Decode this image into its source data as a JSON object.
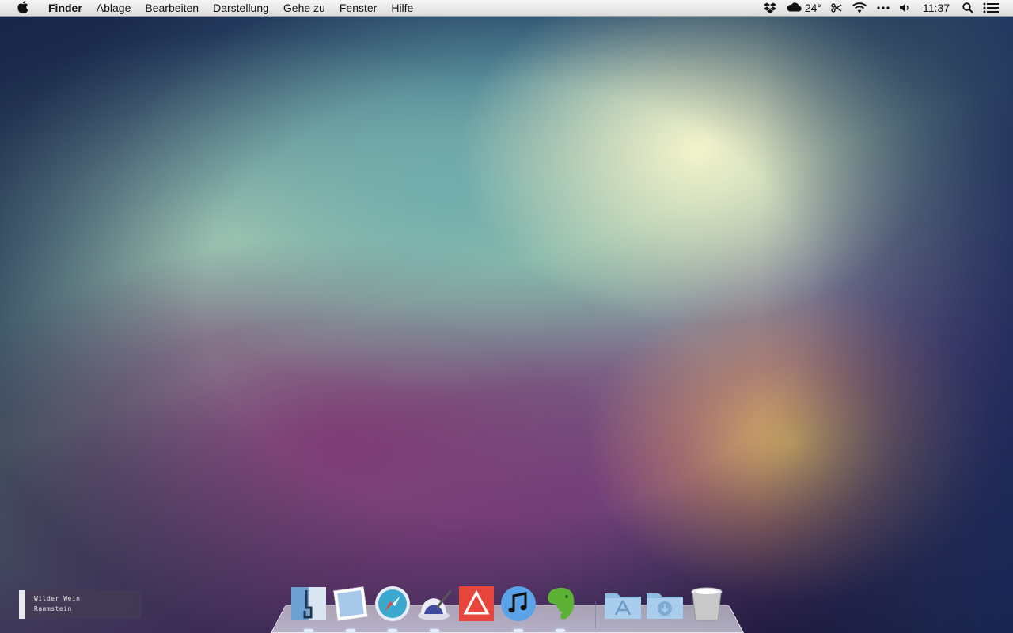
{
  "menubar": {
    "apple_icon": "apple-logo-icon",
    "app_name": "Finder",
    "menus": [
      "Ablage",
      "Bearbeiten",
      "Darstellung",
      "Gehe zu",
      "Fenster",
      "Hilfe"
    ],
    "status": {
      "dropbox_icon": "dropbox-icon",
      "weather_icon": "cloud-icon",
      "temperature": "24°",
      "scissors_icon": "scissors-icon",
      "wifi_icon": "wifi-icon",
      "more_icon": "ellipsis-icon",
      "volume_icon": "speaker-icon",
      "time": "11:37",
      "spotlight_icon": "magnifier-icon",
      "notifications_icon": "list-icon"
    }
  },
  "now_playing": {
    "track": "Wilder Wein",
    "artist": "Rammstein"
  },
  "dock": {
    "apps": [
      {
        "icon": "finder-icon",
        "running": true
      },
      {
        "icon": "mail-icon",
        "running": true
      },
      {
        "icon": "safari-icon",
        "running": true
      },
      {
        "icon": "pen-ink-icon",
        "running": true
      },
      {
        "icon": "red-triangle-app-icon",
        "running": false
      },
      {
        "icon": "itunes-icon",
        "running": true
      },
      {
        "icon": "evernote-icon",
        "running": true
      }
    ],
    "stacks": [
      {
        "icon": "applications-folder-icon"
      },
      {
        "icon": "downloads-folder-icon"
      },
      {
        "icon": "trash-icon"
      }
    ]
  },
  "colors": {
    "menubar_bg": "#e8e8e8",
    "accent_red": "#e8453c",
    "itunes_blue": "#5aa3e8",
    "evernote_green": "#5cb333"
  }
}
